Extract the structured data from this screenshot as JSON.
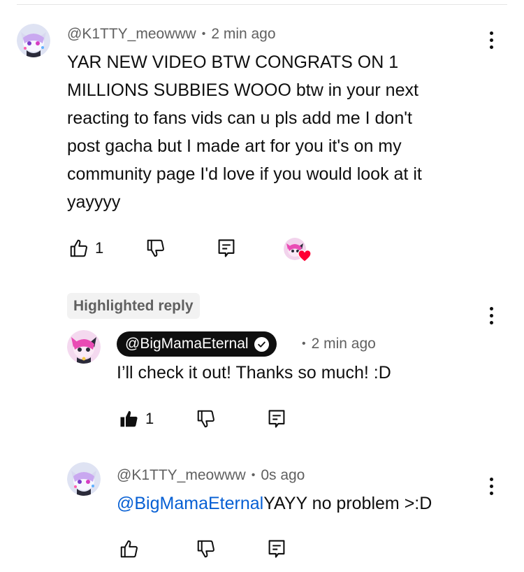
{
  "comment": {
    "author": "@K1TTY_meowww",
    "time": "2 min ago",
    "text_lines": [
      "YAR NEW VIDEO BTW CONGRATS ON 1",
      "MILLIONS SUBBIES WOOO btw in your next",
      "reacting to fans vids can u pls add me I don't",
      "post gacha but I made art for you it's on my",
      "community page I'd love if you would look at it",
      "yayyyy"
    ],
    "like_count": "1",
    "creator_heart": true
  },
  "highlighted_label": "Highlighted reply",
  "reply1": {
    "author": "@BigMamaEternal",
    "verified": true,
    "time": "2 min ago",
    "text": "I’ll check it out! Thanks so much! :D",
    "like_count": "1",
    "liked": true
  },
  "reply2": {
    "author": "@K1TTY_meowww",
    "time": "0s ago",
    "mention": "@BigMamaEternal",
    "text": "YAYY no problem >:D"
  },
  "separator": "•",
  "colors": {
    "text": "#0f0f0f",
    "secondary": "#606060",
    "link": "#065fd4",
    "heart": "#ff0033",
    "pill_bg": "#f2f2f2"
  },
  "icons": [
    "like-icon",
    "dislike-icon",
    "reply-icon",
    "more-vert-icon",
    "verified-icon",
    "heart-icon"
  ]
}
